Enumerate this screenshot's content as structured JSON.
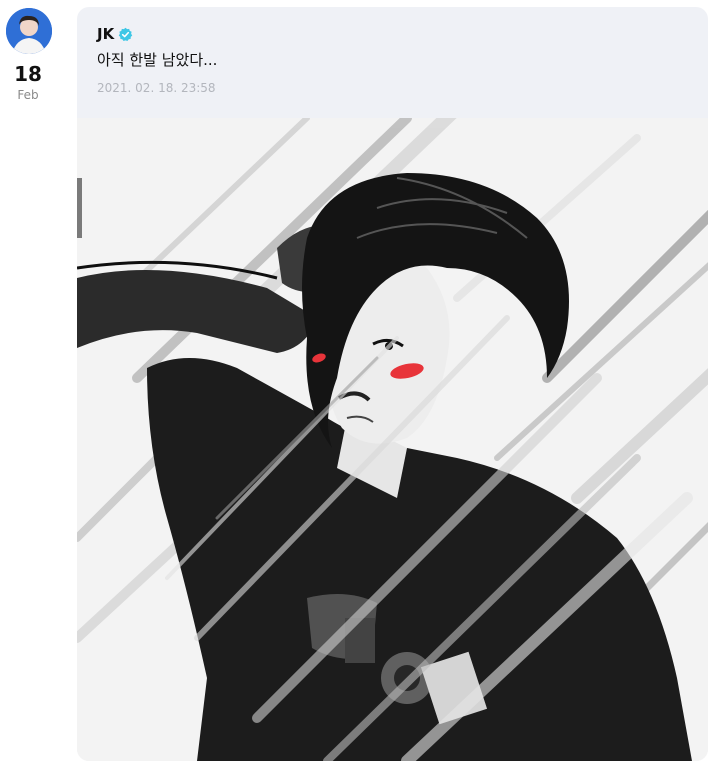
{
  "post": {
    "day": "18",
    "month": "Feb",
    "author": "JK",
    "text": "아직 한발 남았다...",
    "timestamp": "2021. 02. 18. 23:58"
  },
  "icons": {
    "avatar": "profile-avatar",
    "verified": "verified-badge-icon"
  },
  "colors": {
    "verified": "#3fc7e6",
    "card_background": "#eff1f6",
    "blush": "#e8343a"
  }
}
